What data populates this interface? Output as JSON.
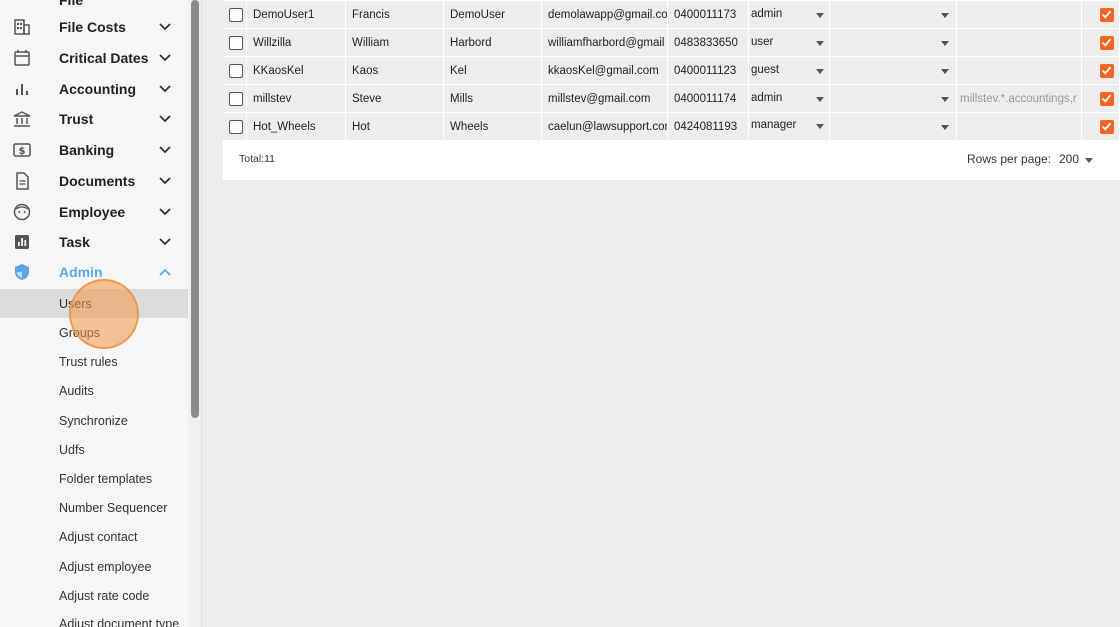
{
  "sidebar": {
    "partial_item": {
      "label": "File"
    },
    "items": [
      {
        "label": "File Costs",
        "icon": "building-icon"
      },
      {
        "label": "Critical Dates",
        "icon": "calendar-icon"
      },
      {
        "label": "Accounting",
        "icon": "bar-chart-icon"
      },
      {
        "label": "Trust",
        "icon": "bank-icon"
      },
      {
        "label": "Banking",
        "icon": "dollar-card-icon"
      },
      {
        "label": "Documents",
        "icon": "document-icon"
      },
      {
        "label": "Employee",
        "icon": "face-icon"
      },
      {
        "label": "Task",
        "icon": "task-chart-icon"
      },
      {
        "label": "Admin",
        "icon": "shield-icon"
      }
    ],
    "admin_subitems": [
      {
        "label": "Users"
      },
      {
        "label": "Groups"
      },
      {
        "label": "Trust rules"
      },
      {
        "label": "Audits"
      },
      {
        "label": "Synchronize"
      },
      {
        "label": "Udfs"
      },
      {
        "label": "Folder templates"
      },
      {
        "label": "Number Sequencer"
      },
      {
        "label": "Adjust contact"
      },
      {
        "label": "Adjust employee"
      },
      {
        "label": "Adjust rate code"
      },
      {
        "label": "Adjust document type"
      }
    ],
    "active_color": "#5aa8e8"
  },
  "table": {
    "rows": [
      {
        "username": "DemoUser1",
        "first": "Francis",
        "last": "DemoUser",
        "email": "demolawapp@gmail.co",
        "phone": "0400011173",
        "role": "admin",
        "group": "",
        "extra": "",
        "enabled": true
      },
      {
        "username": "Willzilla",
        "first": "William",
        "last": "Harbord",
        "email": "williamfharbord@gmail",
        "phone": "0483833650",
        "role": "user",
        "group": "",
        "extra": "",
        "enabled": true
      },
      {
        "username": "KKaosKel",
        "first": "Kaos",
        "last": "Kel",
        "email": "kkaosKel@gmail.com",
        "phone": "0400011123",
        "role": "guest",
        "group": "",
        "extra": "",
        "enabled": true
      },
      {
        "username": "millstev",
        "first": "Steve",
        "last": "Mills",
        "email": "millstev@gmail.com",
        "phone": "0400011174",
        "role": "admin",
        "group": "",
        "extra": "millstev.*.accountings,r",
        "enabled": true
      },
      {
        "username": "Hot_Wheels",
        "first": "Hot",
        "last": "Wheels",
        "email": "caelun@lawsupport.cor",
        "phone": "0424081193",
        "role": "manager",
        "group": "",
        "extra": "",
        "enabled": true
      }
    ],
    "footer": {
      "total": "Total:11",
      "rows_per_page_label": "Rows per page:",
      "rows_per_page_value": "200"
    },
    "accent_color": "#f26522"
  }
}
